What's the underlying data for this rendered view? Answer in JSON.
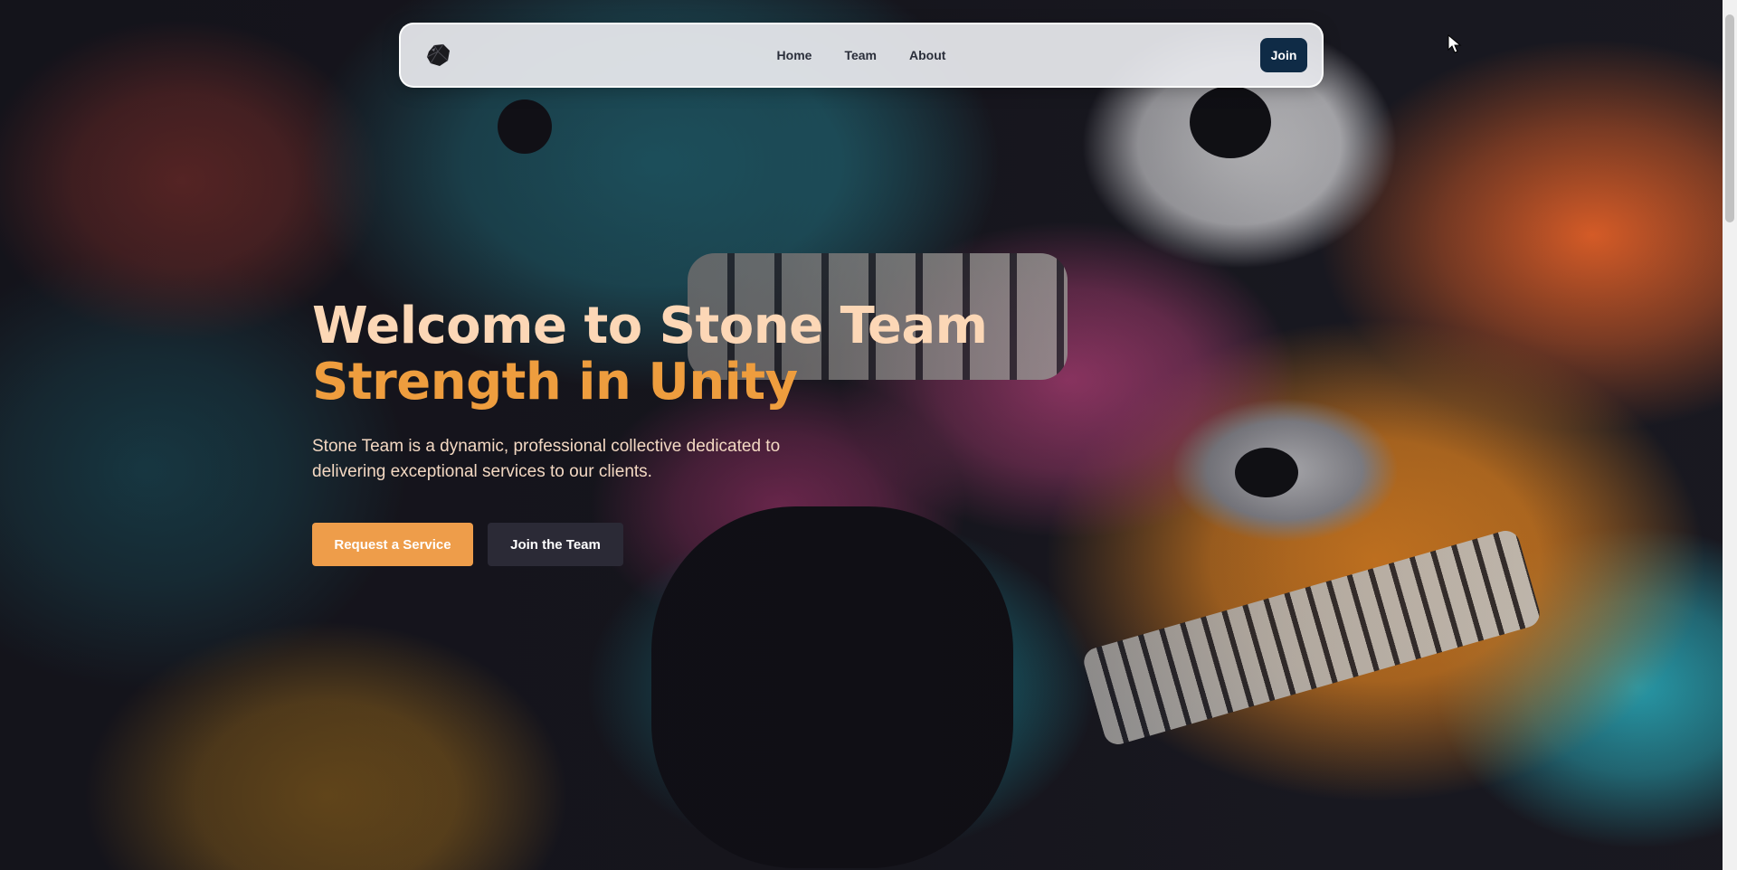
{
  "nav": {
    "logo_icon": "stone-icon",
    "links": [
      {
        "label": "Home"
      },
      {
        "label": "Team"
      },
      {
        "label": "About"
      }
    ],
    "join_label": "Join",
    "join_color": "#0f2b46"
  },
  "hero": {
    "title_line1": "Welcome to Stone Team",
    "title_line2": "Strength in Unity",
    "description": "Stone Team is a dynamic, professional collective dedicated to delivering exceptional services to our clients.",
    "primary_cta": "Request a Service",
    "secondary_cta": "Join the Team",
    "accent_color": "#ee9d3e"
  }
}
